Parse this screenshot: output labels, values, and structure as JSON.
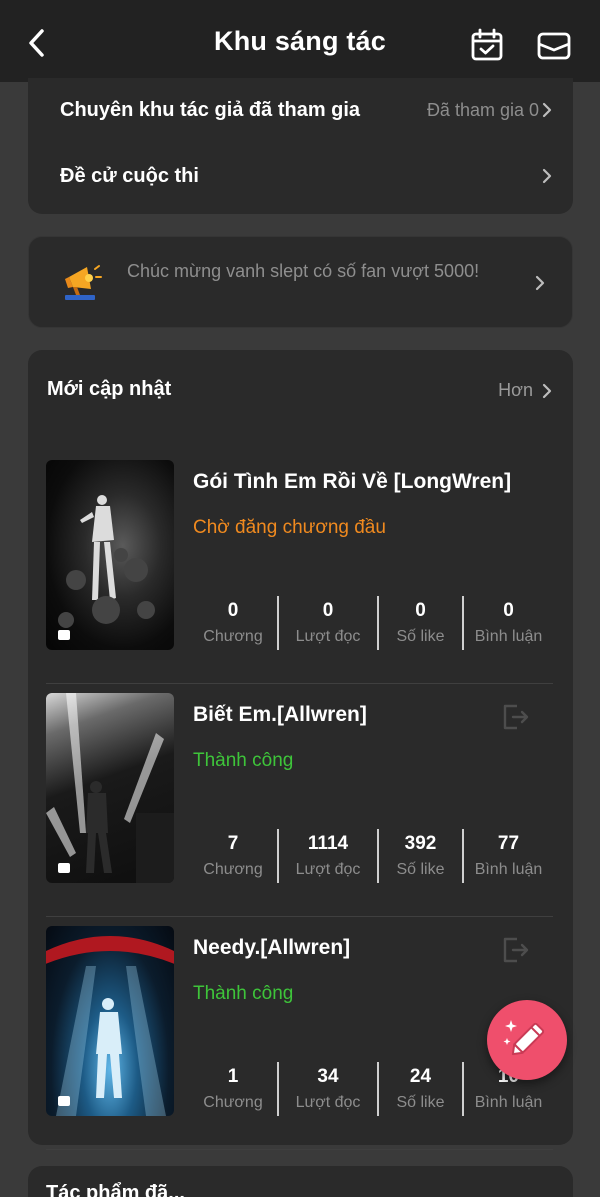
{
  "header": {
    "title": "Khu sáng tác",
    "back_icon": "chevron-left-icon",
    "calendar_icon": "calendar-check-icon",
    "mail_icon": "mail-icon"
  },
  "top_menu": {
    "items": [
      {
        "label": "Chuyên khu tác giả đã tham gia",
        "value": "Đã tham gia 0"
      },
      {
        "label": "Đề cử cuộc thi",
        "value": ""
      }
    ]
  },
  "notice": {
    "icon": "megaphone-icon",
    "text": "Chúc mừng vanh slept có số fan vượt 5000!"
  },
  "updates": {
    "title": "Mới cập nhật",
    "more_label": "Hơn",
    "works": [
      {
        "title": "Gói Tình Em Rồi Về [LongWren]",
        "status": "Chờ đăng chương đầu",
        "status_color": "#f08a1f",
        "show_exit": false,
        "stats": [
          {
            "value": "0",
            "caption": "Chương"
          },
          {
            "value": "0",
            "caption": "Lượt đọc"
          },
          {
            "value": "0",
            "caption": "Số like"
          },
          {
            "value": "0",
            "caption": "Bình luận"
          }
        ]
      },
      {
        "title": "Biết Em.[Allwren]",
        "status": "Thành công",
        "status_color": "#3ec43a",
        "show_exit": true,
        "stats": [
          {
            "value": "7",
            "caption": "Chương"
          },
          {
            "value": "1114",
            "caption": "Lượt đọc"
          },
          {
            "value": "392",
            "caption": "Số like"
          },
          {
            "value": "77",
            "caption": "Bình luận"
          }
        ]
      },
      {
        "title": "Needy.[Allwren]",
        "status": "Thành công",
        "status_color": "#3ec43a",
        "show_exit": true,
        "stats": [
          {
            "value": "1",
            "caption": "Chương"
          },
          {
            "value": "34",
            "caption": "Lượt đọc"
          },
          {
            "value": "24",
            "caption": "Số like"
          },
          {
            "value": "10",
            "caption": "Bình luận"
          }
        ]
      }
    ]
  },
  "bottom_section": {
    "title_partial": "Tác phẩm đã..."
  },
  "fab": {
    "icon": "magic-pencil-icon",
    "color": "#ef4f6c"
  }
}
